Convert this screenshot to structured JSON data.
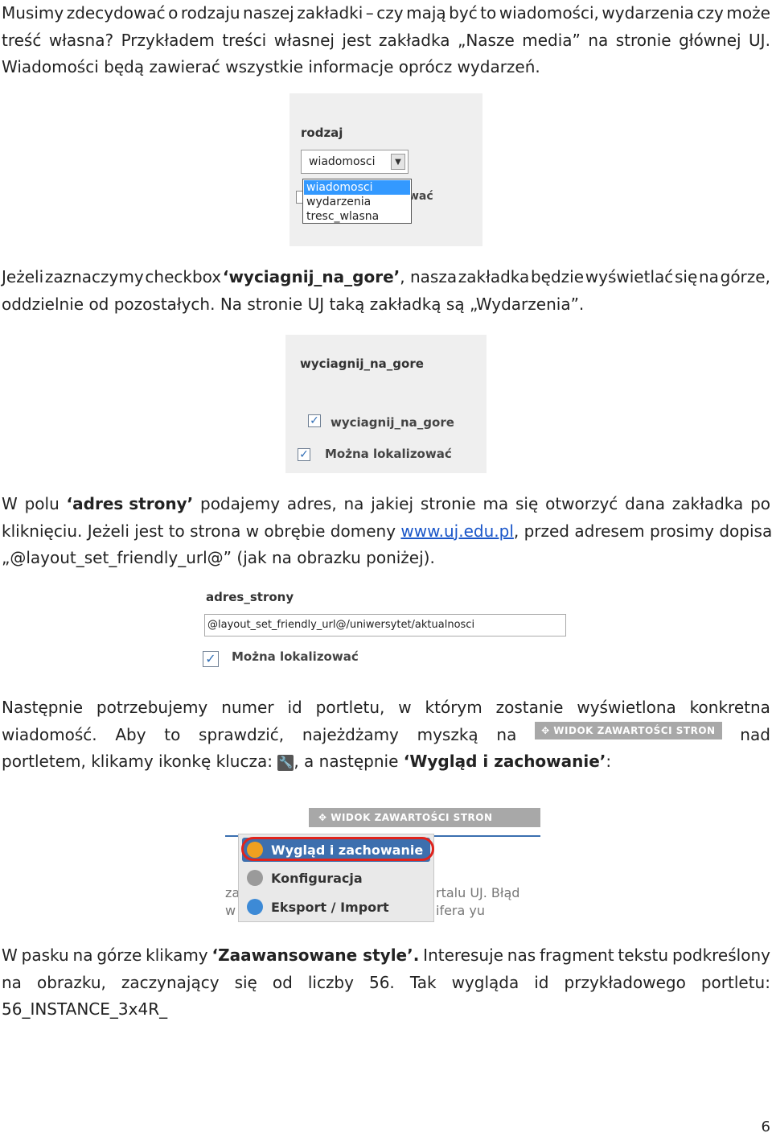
{
  "p1": {
    "line1": [
      "Musimy",
      "zdecydować",
      "o",
      "rodzaju",
      "naszej",
      "zakładki",
      "–",
      "czy",
      "mają",
      "być",
      "to",
      "wiadomości,",
      "wydarzenia",
      "czy",
      "może"
    ],
    "line2": [
      "treść",
      "własna?",
      "Przykładem",
      "treści",
      "własnej",
      "jest",
      "zakładka",
      "„Nasze",
      "media”",
      "na",
      "stronie",
      "głównej",
      "UJ."
    ],
    "line3": "Wiadomości będą zawierać wszystkie informacje oprócz wydarzeń."
  },
  "fig1": {
    "label": "rodzaj",
    "selected_value": "wiadomosci",
    "options": [
      "wiadomosci",
      "wydarzenia",
      "tresc_wlasna"
    ],
    "behind_text": "wać"
  },
  "p2": {
    "line1_pre": [
      "Jeżeli",
      "zaznaczymy",
      "checkbox"
    ],
    "line1_bold": "‘wyciagnij_na_gore’",
    "line1_post": [
      ", nasza",
      "zakładka",
      "będzie",
      "wyświetlać",
      "się",
      "na",
      "górze,"
    ],
    "line2": "oddzielnie od pozostałych. Na stronie UJ taką zakładką są „Wydarzenia”."
  },
  "fig2": {
    "label": "wyciagnij_na_gore",
    "checkbox1": "wyciagnij_na_gore",
    "checkbox2": "Można lokalizować",
    "check_mark": "✓"
  },
  "p3": {
    "line1_a": "W",
    "line1_b": "polu",
    "line1_bold": "‘adres strony’",
    "line1_rest": [
      "podajemy",
      "adres,",
      "na",
      "jakiej",
      "stronie",
      "ma",
      "się",
      "otworzyć",
      "dana",
      "zakładka",
      "po"
    ],
    "line2_pre": "kliknięciu. Jeżeli jest to strona w obrębie domeny ",
    "line2_link": "www.uj.edu.pl",
    "line2_post": ", przed adresem prosimy dopisać",
    "line3": "„@layout_set_friendly_url@” (jak na obrazku poniżej)."
  },
  "fig3": {
    "label": "adres_strony",
    "input_value": "@layout_set_friendly_url@/uniwersytet/aktualnosci",
    "checkbox_label": "Można lokalizować",
    "check_mark": "✓"
  },
  "p4": {
    "line1": [
      "Następnie",
      "potrzebujemy",
      "numer",
      "id",
      "portletu,",
      "w",
      "którym",
      "zostanie",
      "wyświetlona",
      "konkretna"
    ],
    "line2_words": [
      "wiadomość.",
      "Aby",
      "to",
      "sprawdzić,",
      "najeżdżamy",
      "myszką",
      "na"
    ],
    "line2_bar": "✥ WIDOK ZAWARTOŚCI STRON",
    "line2_end": "nad",
    "line3_pre": "portletem, klikamy ikonkę klucza: ",
    "line3_wrench": "🔧",
    "line3_mid": ", a następnie ",
    "line3_bold": "‘Wygląd i zachowanie’",
    "line3_end": ":"
  },
  "fig4": {
    "bar_text": "✥ WIDOK ZAWARTOŚCI STRON",
    "menu_items": [
      "Wygląd i zachowanie",
      "Konfiguracja",
      "Eksport / Import"
    ],
    "bg_left_1": "za",
    "bg_left_2": "w",
    "bg_right_1": "rtalu UJ. Błąd",
    "bg_right_2": "ifera yu"
  },
  "p5": {
    "line1_pre": [
      "W",
      "pasku",
      "na",
      "górze",
      "klikamy"
    ],
    "line1_bold": "‘Zaawansowane style’.",
    "line1_post": [
      "Interesuje",
      "nas",
      "fragment",
      "tekstu",
      "podkreślony"
    ],
    "line2": [
      "na",
      "obrazku,",
      "zaczynający",
      "się",
      "od",
      "liczby",
      "56.",
      "Tak",
      "wygląda",
      "id",
      "przykładowego",
      "portletu:"
    ],
    "line3": "56_INSTANCE_3x4R_"
  },
  "page_number": "6",
  "colors": {
    "link": "#1a56c9",
    "menu_active": "#3d6fae",
    "highlight": "#e0231c"
  }
}
